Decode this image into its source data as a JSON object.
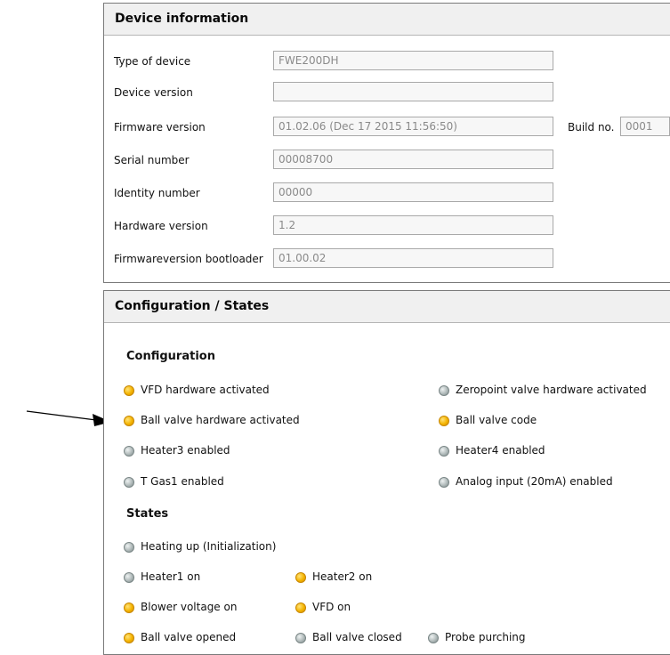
{
  "device_info": {
    "title": "Device information",
    "rows": [
      {
        "label": "Type of device",
        "value": "FWE200DH"
      },
      {
        "label": "Device version",
        "value": ""
      },
      {
        "label": "Firmware version",
        "value": "01.02.06 (Dec 17 2015 11:56:50)"
      },
      {
        "label": "Serial number",
        "value": "00008700"
      },
      {
        "label": "Identity number",
        "value": "00000"
      },
      {
        "label": "Hardware version",
        "value": "1.2"
      },
      {
        "label": "Firmwareversion bootloader",
        "value": "01.00.02"
      }
    ],
    "build": {
      "label": "Build no.",
      "value": "0001"
    }
  },
  "config_states": {
    "title": "Configuration / States",
    "configuration": {
      "heading": "Configuration",
      "items": [
        {
          "label": "VFD hardware activated",
          "state": "on"
        },
        {
          "label": "Zeropoint valve hardware activated",
          "state": "off"
        },
        {
          "label": "Ball valve hardware activated",
          "state": "on"
        },
        {
          "label": "Ball valve code",
          "state": "on"
        },
        {
          "label": "Heater3 enabled",
          "state": "off"
        },
        {
          "label": "Heater4 enabled",
          "state": "off"
        },
        {
          "label": "T Gas1 enabled",
          "state": "off"
        },
        {
          "label": "Analog input (20mA) enabled",
          "state": "off"
        }
      ]
    },
    "states": {
      "heading": "States",
      "items": [
        {
          "label": "Heating up (Initialization)",
          "state": "off"
        },
        {
          "label": "Heater1 on",
          "state": "off"
        },
        {
          "label": "Heater2 on",
          "state": "on"
        },
        {
          "label": "Blower voltage on",
          "state": "on"
        },
        {
          "label": "VFD on",
          "state": "on"
        },
        {
          "label": "Ball valve opened",
          "state": "on"
        },
        {
          "label": "Ball valve closed",
          "state": "off"
        },
        {
          "label": "Probe purching",
          "state": "off"
        }
      ]
    }
  },
  "colors": {
    "indicator_on": "#f4b400",
    "indicator_off": "#aab4b4"
  }
}
